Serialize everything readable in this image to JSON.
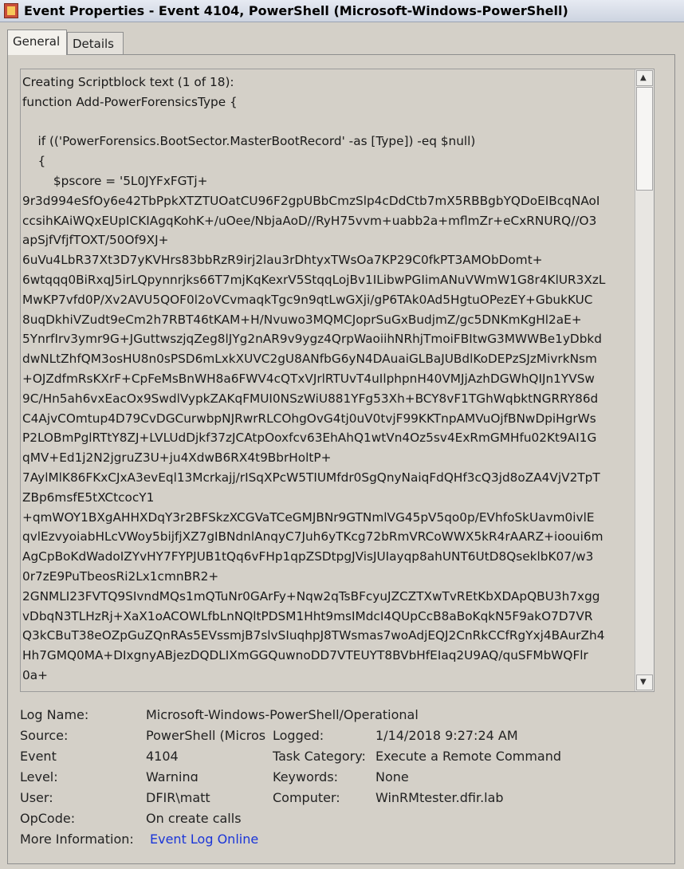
{
  "window": {
    "title": "Event Properties - Event 4104, PowerShell (Microsoft-Windows-PowerShell)"
  },
  "tabs": [
    {
      "label": "General"
    },
    {
      "label": "Details"
    }
  ],
  "event_text": [
    "Creating Scriptblock text (1 of 18):",
    "function Add-PowerForensicsType {",
    "",
    "    if (('PowerForensics.BootSector.MasterBootRecord' -as [Type]) -eq $null)",
    "    {",
    "        $pscore = '5L0JYFxFGTj+",
    "9r3d994eSfOy6e42TbPpkXTZTUOatCU96F2gpUBbCmzSlp4cDdCtb7mX5RBBgbYQDoEIBcqNAoI",
    "ccsihKAiWQxEUpICKIAgqKohK+/uOee/NbjaAoD//RyH75vvm+uabb2a+mflmZr+eCxRNURQ//O3",
    "apSjfVfjfTOXT/50Of9XJ+",
    "6uVu4LbR37Xt3D7yKVHrs83bbRzR9irj2lau3rDhtyxTWsOa7KP29C0fkPT3AMObDomt+",
    "6wtqqq0BiRxqJ5irLQpynnrjks66T7mjKqKexrV5StqqLojBv1ILibwPGIimANuVWmW1G8r4KlUR3XzL",
    "MwKP7vfd0P/Xv2AVU5QOF0l2oVCvmaqkTgc9n9qtLwGXji/gP6TAk0Ad5HgtuOPezEY+GbukKUC",
    "8uqDkhiVZudt9eCm2h7RBT46tKAM+H/Nvuwo3MQMCJoprSuGxBudjmZ/gc5DNKmKgHl2aE+",
    "5YnrfIrv3ymr9G+JGuttwszjqZeg8lJYg2nAR9v9ygz4QrpWaoiihNRhjTmoiFBItwG3MWWBe1yDbkd",
    "dwNLtZhfQM3osHU8n0sPSD6mLxkXUVC2gU8ANfbG6yN4DAuaiGLBaJUBdlKoDEPzSJzMivrkNsm",
    "+OJZdfmRsKXrF+CpFeMsBnWH8a6FWV4cQTxVJrlRTUvT4uIlphpnH40VMJjAzhDGWhQIJn1YVSw",
    "9C/Hn5ah6vxEacOx9SwdlVypkZAKqFMUI0NSzWiU881YFg53Xh+BCY8vF1TGhWqbktNGRRY86d",
    "C4AjvCOmtup4D79CvDGCurwbpNJRwrRLCOhgOvG4tj0uV0tvjF99KKTnpAMVuOjfBNwDpiHgrWs",
    "P2LOBmPglRTtY8ZJ+LVLUdDjkf37zJCAtpOoxfcv63EhAhQ1wtVn4Oz5sv4ExRmGMHfu02Kt9AI1G",
    "qMV+Ed1j2N2jgruZ3U+ju4XdwB6RX4t9BbrHoltP+",
    "7AylMlK86FKxCJxA3evEql13Mcrkajj/rISqXPcW5TIUMfdr0SgQnyNaiqFdQHf3cQ3jd8oZA4VjV2TpT",
    "ZBp6msfE5tXCtcocY1",
    "+qmWOY1BXgAHHXDqY3r2BFSkzXCGVaTCeGMJBNr9GTNmlVG45pV5qo0p/EVhfoSkUavm0ivlE",
    "qvlEzvyoiabHLcVWoy5bijfjXZ7gIBNdnlAnqyC7Juh6yTKcg72bRmVRCoWWX5kR4rAARZ+iooui6m",
    "AgCpBoKdWadoIZYvHY7FYPJUB1tQq6vFHp1qpZSDtpgJVisJUIayqp8ahUNT6UtD8QseklbK07/w3",
    "0r7zE9PuTbeosRi2Lx1cmnBR2+",
    "2GNMLI23FVTQ9SIvndMQs1mQTuNr0GArFy+Nqw2qTsBFcyuJZCZTXwTvREtKbXDApQBU3h7xgg",
    "vDbqN3TLHzRj+XaX1oACOWLfbLnNQltPDSM1Hht9msIMdcI4QUpCcB8aBoKqkN5F9akO7D7VR",
    "Q3kCBuT38eOZpGuZQnRAs5EVssmjB7slvSIuqhpJ8TWsmas7woAdjEQJ2CnRkCCfRgYxj4BAurZh4",
    "Hh7GMQ0MA+DIxgnyABjezDQDLIXmGGQuwnoDD7VTEUYT8BVbHfEIaq2U9AQ/quSFMbWQFlr",
    "0a+"
  ],
  "fields": {
    "log_name_label": "Log Name:",
    "log_name_value": "Microsoft-Windows-PowerShell/Operational",
    "source_label": "Source:",
    "source_value": "PowerShell (Micros",
    "logged_label": "Logged:",
    "logged_value": "1/14/2018 9:27:24 AM",
    "event_label": "Event",
    "event_value": "4104",
    "task_category_label": "Task Category:",
    "task_category_value": "Execute a Remote Command",
    "level_label": "Level:",
    "level_value": "Warning",
    "keywords_label": "Keywords:",
    "keywords_value": "None",
    "user_label": "User:",
    "user_value": "DFIR\\matt",
    "computer_label": "Computer:",
    "computer_value": "WinRMtester.dfir.lab",
    "opcode_label": "OpCode:",
    "opcode_value": "On create calls",
    "more_info_label": "More Information:",
    "more_info_link": "Event Log Online"
  },
  "colors": {
    "window_bg": "#d4d0c8",
    "link": "#1a35d8"
  }
}
